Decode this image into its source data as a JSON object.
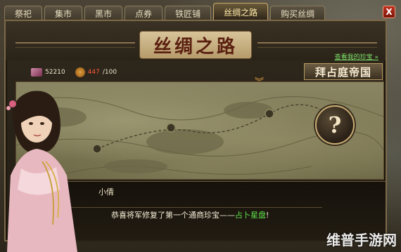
{
  "tabs": [
    {
      "label": "祭祀",
      "active": false
    },
    {
      "label": "集市",
      "active": false
    },
    {
      "label": "黑市",
      "active": false
    },
    {
      "label": "点券",
      "active": false
    },
    {
      "label": "铁匠铺",
      "active": false
    },
    {
      "label": "丝绸之路",
      "active": true
    },
    {
      "label": "购买丝绸",
      "active": false
    }
  ],
  "close_label": "X",
  "panel": {
    "title": "丝绸之路",
    "treasure_link": "查看我的珍宝 »",
    "silk_amount": "52210",
    "bag_current": "447",
    "bag_max": "/100",
    "destination": "拜占庭帝国",
    "info_symbol": "?"
  },
  "dialog": {
    "speaker": "小倩",
    "message_prefix": "恭喜将军修复了第一个通商珍宝——",
    "message_highlight": "占卜星盘",
    "message_suffix": "!",
    "more_symbol": "︾"
  },
  "watermark": "维普手游网",
  "colors": {
    "accent_gold": "#c8ac74",
    "highlight_green": "#5ee04a",
    "bag_red": "#ff5a3a"
  }
}
